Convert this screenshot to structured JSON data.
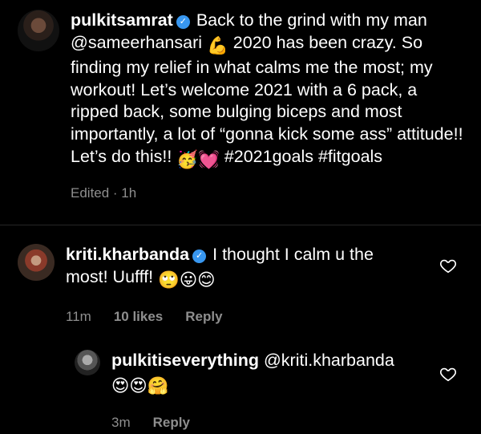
{
  "caption": {
    "username": "pulkitsamrat",
    "text_line1": "Back to the grind with my man",
    "mention": "@sameerhansari",
    "flex_emoji": "💪",
    "body": "2020 has been crazy. So finding my relief in what calms me the most; my workout! Let’s welcome 2021 with a 6 pack, a ripped back, some bulging biceps and most importantly, a lot of “gonna kick some ass” attitude!! Let’s do this!!",
    "emojis": "🥳💓",
    "hashtags": "#2021goals #fitgoals",
    "meta": "Edited · 1h"
  },
  "comments": [
    {
      "username": "kriti.kharbanda",
      "text": "I thought I calm u the most! Uufff!",
      "emojis": "🙄😛😊",
      "time": "11m",
      "likes": "10 likes",
      "reply_label": "Reply"
    },
    {
      "username": "pulkitiseverything",
      "text": "@kriti.kharbanda",
      "emojis": "😍😍🤗",
      "time": "3m",
      "reply_label": "Reply"
    }
  ],
  "colors": {
    "background": "#000000",
    "text": "#ffffff",
    "muted": "#8e8e8e",
    "verified": "#3897f0",
    "divider": "#262626"
  },
  "icons": [
    "verified-badge-icon",
    "heart-outline-icon"
  ]
}
